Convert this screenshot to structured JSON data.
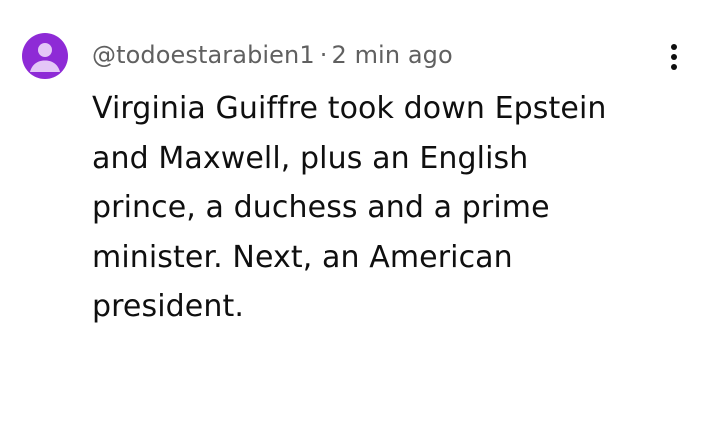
{
  "comment": {
    "author": "@todoestarabien1",
    "separator": "·",
    "time": "2 min ago",
    "text_lines": [
      "Virginia Guiffre took down Epstein",
      "and Maxwell, plus an English",
      "prince, a duchess and a prime",
      "minister. Next, an American",
      "president."
    ],
    "avatar_icon": "default-user-icon",
    "menu_icon": "more-vert-icon"
  },
  "colors": {
    "avatar_bg": "#8e2ad6",
    "avatar_glyph": "#e4c6f7",
    "meta_text": "#606060",
    "body_text": "#0f0f0f"
  }
}
